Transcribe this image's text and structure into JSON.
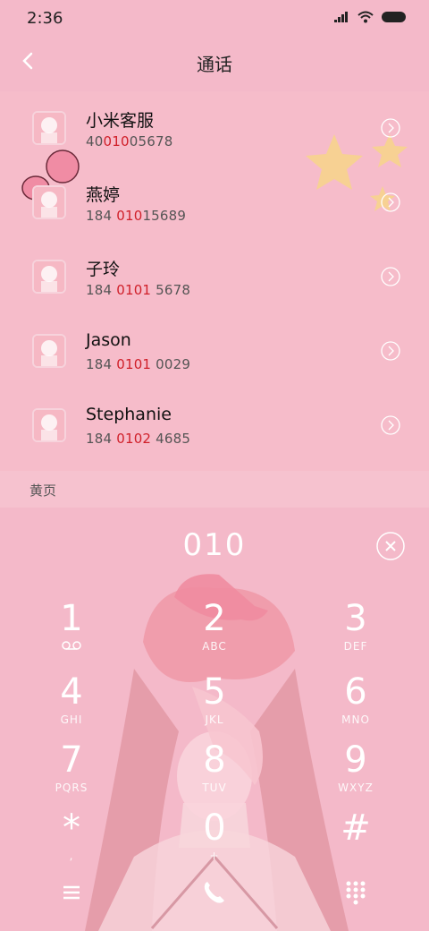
{
  "status": {
    "time": "2:36"
  },
  "header": {
    "title": "通话"
  },
  "contacts": [
    {
      "name": "小米客服",
      "number_pre": "40",
      "number_hl": "010",
      "number_post": "05678"
    },
    {
      "name": "燕婷",
      "number_pre": "184 ",
      "number_hl": "010",
      "number_post": "15689"
    },
    {
      "name": "子玲",
      "number_pre": "184 ",
      "number_hl": "0101",
      "number_post": " 5678"
    },
    {
      "name": "Jason",
      "number_pre": "184 ",
      "number_hl": "0101",
      "number_post": " 0029"
    },
    {
      "name": "Stephanie",
      "number_pre": "184 ",
      "number_hl": "0102",
      "number_post": " 4685"
    }
  ],
  "section_label": "黄页",
  "dialer": {
    "input": "010",
    "keys": [
      {
        "digit": "1",
        "letters": ""
      },
      {
        "digit": "2",
        "letters": "ABC"
      },
      {
        "digit": "3",
        "letters": "DEF"
      },
      {
        "digit": "4",
        "letters": "GHI"
      },
      {
        "digit": "5",
        "letters": "JKL"
      },
      {
        "digit": "6",
        "letters": "MNO"
      },
      {
        "digit": "7",
        "letters": "PQRS"
      },
      {
        "digit": "8",
        "letters": "TUV"
      },
      {
        "digit": "9",
        "letters": "WXYZ"
      },
      {
        "digit": "*",
        "letters": ","
      },
      {
        "digit": "0",
        "letters": "+"
      },
      {
        "digit": "#",
        "letters": ""
      }
    ]
  },
  "colors": {
    "highlight": "#d0202a",
    "background": "#f4b9c9"
  }
}
